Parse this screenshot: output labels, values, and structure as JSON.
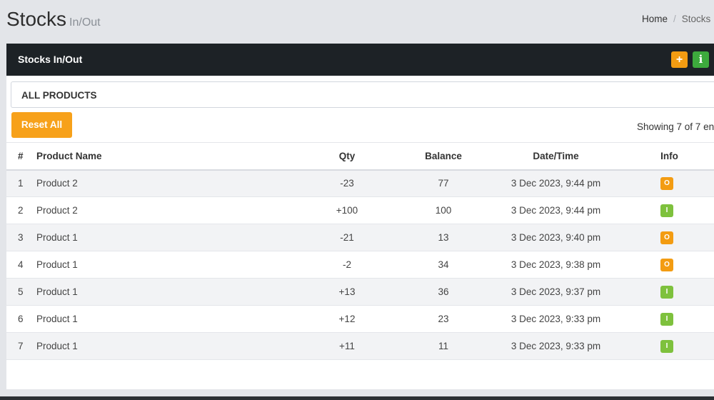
{
  "header": {
    "title": "Stocks",
    "subtitle": "In/Out",
    "breadcrumb": {
      "home": "Home",
      "separator": "/",
      "current": "Stocks"
    }
  },
  "box": {
    "title": "Stocks In/Out",
    "add_button": "+",
    "info_button": "i"
  },
  "filter": {
    "label": "ALL PRODUCTS"
  },
  "reset_label": "Reset All",
  "showing_text": "Showing 7 of 7 en",
  "table": {
    "columns": [
      "#",
      "Product Name",
      "Qty",
      "Balance",
      "Date/Time",
      "Info"
    ],
    "rows": [
      {
        "num": "1",
        "name": "Product 2",
        "qty": "-23",
        "balance": "77",
        "datetime": "3 Dec 2023, 9:44 pm",
        "info": "O",
        "type": "out"
      },
      {
        "num": "2",
        "name": "Product 2",
        "qty": "+100",
        "balance": "100",
        "datetime": "3 Dec 2023, 9:44 pm",
        "info": "I",
        "type": "in"
      },
      {
        "num": "3",
        "name": "Product 1",
        "qty": "-21",
        "balance": "13",
        "datetime": "3 Dec 2023, 9:40 pm",
        "info": "O",
        "type": "out"
      },
      {
        "num": "4",
        "name": "Product 1",
        "qty": "-2",
        "balance": "34",
        "datetime": "3 Dec 2023, 9:38 pm",
        "info": "O",
        "type": "out"
      },
      {
        "num": "5",
        "name": "Product 1",
        "qty": "+13",
        "balance": "36",
        "datetime": "3 Dec 2023, 9:37 pm",
        "info": "I",
        "type": "in"
      },
      {
        "num": "6",
        "name": "Product 1",
        "qty": "+12",
        "balance": "23",
        "datetime": "3 Dec 2023, 9:33 pm",
        "info": "I",
        "type": "in"
      },
      {
        "num": "7",
        "name": "Product 1",
        "qty": "+11",
        "balance": "11",
        "datetime": "3 Dec 2023, 9:33 pm",
        "info": "I",
        "type": "in"
      }
    ]
  },
  "colors": {
    "accent_orange": "#f39c12",
    "accent_green": "#7ec13d",
    "header_dark": "#1d2226"
  }
}
